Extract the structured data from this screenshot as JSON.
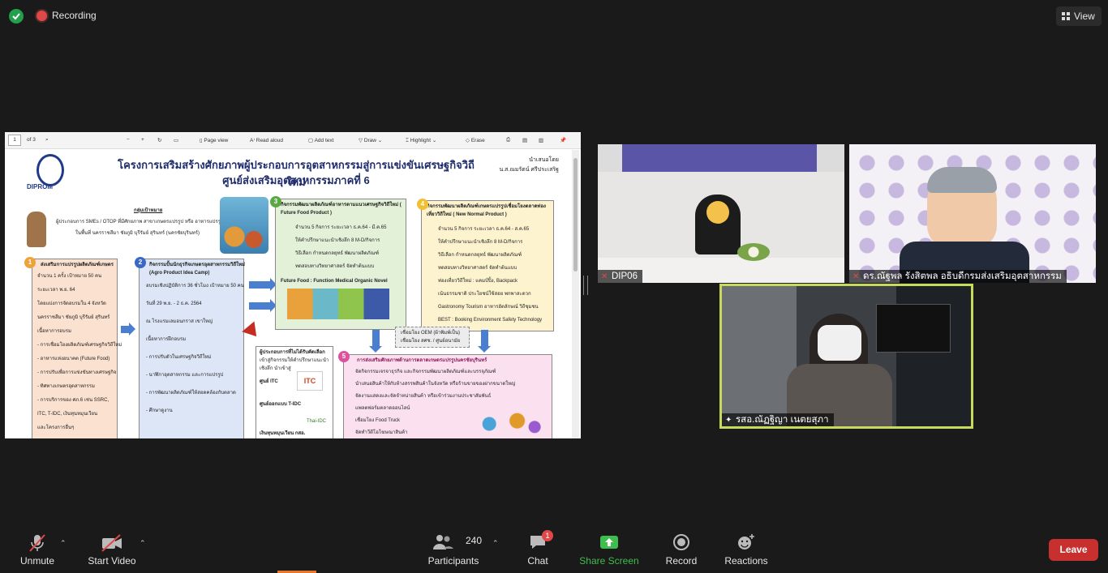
{
  "topbar": {
    "recording_label": "Recording",
    "view_label": "View"
  },
  "shared_document": {
    "toolbar": {
      "page_number": "1",
      "page_total": "of 3",
      "page_view": "Page view",
      "read_aloud": "Read aloud",
      "add_text": "Add text",
      "draw": "Draw",
      "highlight": "Highlight",
      "erase": "Erase"
    },
    "poster": {
      "logo_text": "DIPROM",
      "logo_sub": "กรมส่งเสริมอุตสาหกรรม",
      "title_line1": "โครงการเสริมสร้างศักยภาพผู้ประกอบการอุตสาหกรรมสู่การแข่งขันเศรษฐกิจวิถีใหม่",
      "title_line2": "ศูนย์ส่งเสริมอุตสาหกรรมภาคที่ 6",
      "presenter_label": "นำเสนอโดย",
      "presenter_name": "น.ส.ณมรัตน์ ศรีประเสริฐ",
      "target_heading": "กลุ่มเป้าหมาย",
      "target_line1": "ผู้ประกอบการ SMEs / OTOP ที่มีศักยภาพ สาขาเกษตรแปรรูป หรือ อาหารแปรรูป",
      "target_line2": "ในพื้นที่ นครราชสีมา ชัยภูมิ บุรีรัมย์ สุรินทร์ (นครชัยบุรินทร์)",
      "box1_title": "ส่งเสริมการแปรรูปผลิตภัณฑ์เกษตร",
      "box1_lines": [
        "จำนวน 1 ครั้ง เป้าหมาย 50 คน",
        "ระยะเวลา พ.ย. 64",
        "โดยแบ่งการจัดอบรมใน 4 จังหวัด",
        "นครราชสีมา ชัยภูมิ บุรีรัมย์ สุรินทร์",
        "เนื้อหาการอบรม",
        "- การเชื่อมโยงผลิตภัณฑ์เศรษฐกิจวิถีใหม่",
        "- อาหารแห่งอนาคต (Future Food)",
        "- การปรับเพื่อการแข่งขันทางเศรษฐกิจ",
        "- ทิศทางเกษตรอุตสาหกรรม",
        "- การบริการของ ศภ.6 เช่น SSRC,",
        "ITC, T-IDC, เงินทุนหมุนเวียน",
        "และโครงการอื่นๆ"
      ],
      "box2_title": "กิจกรรมปั้นนักธุรกิจเกษตรอุตสาหกรรมวิถีใหม่",
      "box2_sub": "(Agro Product Idea Camp)",
      "box2_lines": [
        "อบรมเชิงปฏิบัติการ 36 ชั่วโมง เป้าหมาย 50 คน",
        "วันที่ 29 พ.ย. - 2 ธ.ค. 2564",
        "ณ โรงแรมเลมอนกราส เขาใหญ่",
        "เนื้อหาการฝึกอบรม",
        "- การปรับตัวในเศรษฐกิจวิถีใหม่",
        "- นาฬิกาอุตสาหกรรม และการแปรรูป",
        "- การพัฒนาผลิตภัณฑ์ให้สอดคล้องกับตลาด",
        "- ศึกษาดูงาน"
      ],
      "box3_title": "กิจกรรมพัฒนาผลิตภัณฑ์อาหารตามแนวเศรษฐกิจวิถีใหม่ ( Future Food Product )",
      "box3_lines": [
        "จำนวน 5 กิจการ ระยะเวลา ธ.ค.64 - มี.ค.65",
        "ให้คำปรึกษาแนะนำเชิงลึก 8 M-D/กิจการ",
        "วิธีเลือก กำหนดกลยุทธ์ พัฒนาผลิตภัณฑ์",
        "ทดสอบทางวิทยาศาสตร์ จัดทำต้นแบบ"
      ],
      "box3_footer": "Future Food : Function Medical Organic Novel",
      "box4_title": "กิจกรรมพัฒนาผลิตภัณฑ์เกษตรแปรรูปเชื่อมโยงตลาดท่องเที่ยววิถีใหม่ ( New Normal Product )",
      "box4_lines": [
        "จำนวน 5 กิจการ ระยะเวลา ธ.ค.64 - ส.ค.65",
        "ให้คำปรึกษาแนะนำเชิงลึก 8 M-D/กิจการ",
        "วิธีเลือก กำหนดกลยุทธ์ พัฒนาผลิตภัณฑ์",
        "ทดสอบทางวิทยาศาสตร์ จัดทำต้นแบบ",
        "ท่องเที่ยววิถีใหม่ : แคมป์ปิ้ง, Backpack",
        "เน้นธรรมชาติ ประโยชน์ใช้สอย พกพาสะดวก",
        "Gastronomy Tourism อาหารอัตลักษณ์ วิถีชุมชน",
        "BEST : Booking Environment Safety Technology"
      ],
      "oem_box": "เชื่อมโยง OEM (ผ้าพิมพ์เป็น)\nเชื่อมโยง สศช. / ศูนย์อนามัย",
      "box5_title": "การส่งเสริมศักยภาพด้านการตลาดเกษตรแปรรูปนครชัยบุรินทร์",
      "box5_lines": [
        "จัดกิจกรรมเจรจาธุรกิจ และกิจกรรมพัฒนาผลิตภัณฑ์และบรรจุภัณฑ์",
        "นำเสนอสินค้าให้กับห้างสรรพสินค้าในจังหวัด หรือร้านขายของฝากขนาดใหญ่",
        "จัดงานแสดงและจัดจำหน่ายสินค้า หรือเข้าร่วมงานประชาสัมพันธ์",
        "แพลตฟอร์มตลาดออนไลน์",
        "เชื่อมโยง Food Truck",
        "จัดทำวีดีโอโฆษณาสินค้า"
      ],
      "service_title": "ผู้ประกอบการที่ไม่ได้รับคัดเลือก",
      "service_lines": [
        "เข้าสู่กิจกรรมให้คำปรึกษาแนะนำ",
        "เชิงลึก นำเข้าสู่"
      ],
      "service_itc": "ศูนย์ ITC",
      "service_tidc": "ศูนย์ออกแบบ T-IDC",
      "service_fund": "เงินทุนหมุนเวียน กสอ.",
      "itc_logo": "ITC",
      "tidc_logo": "Thai-IDC"
    }
  },
  "participants_videos": [
    {
      "name": "DIP06",
      "muted": true
    },
    {
      "name": "ดร.ณัฐพล รังสิตพล อธิบดีกรมส่งเสริมอุตสาหกรรม",
      "muted": true
    },
    {
      "name": "รสอ.ณัฏฐิญา เนตยสุภา",
      "muted": false
    }
  ],
  "bottombar": {
    "unmute": "Unmute",
    "start_video": "Start Video",
    "participants_count": "240",
    "participants": "Participants",
    "chat": "Chat",
    "chat_badge": "1",
    "share_screen": "Share Screen",
    "record": "Record",
    "reactions": "Reactions",
    "leave": "Leave"
  },
  "colors": {
    "background": "#1a1a1a",
    "active_speaker": "#c8da5c",
    "share_green": "#3fbd4e",
    "leave_red": "#c8302f"
  }
}
